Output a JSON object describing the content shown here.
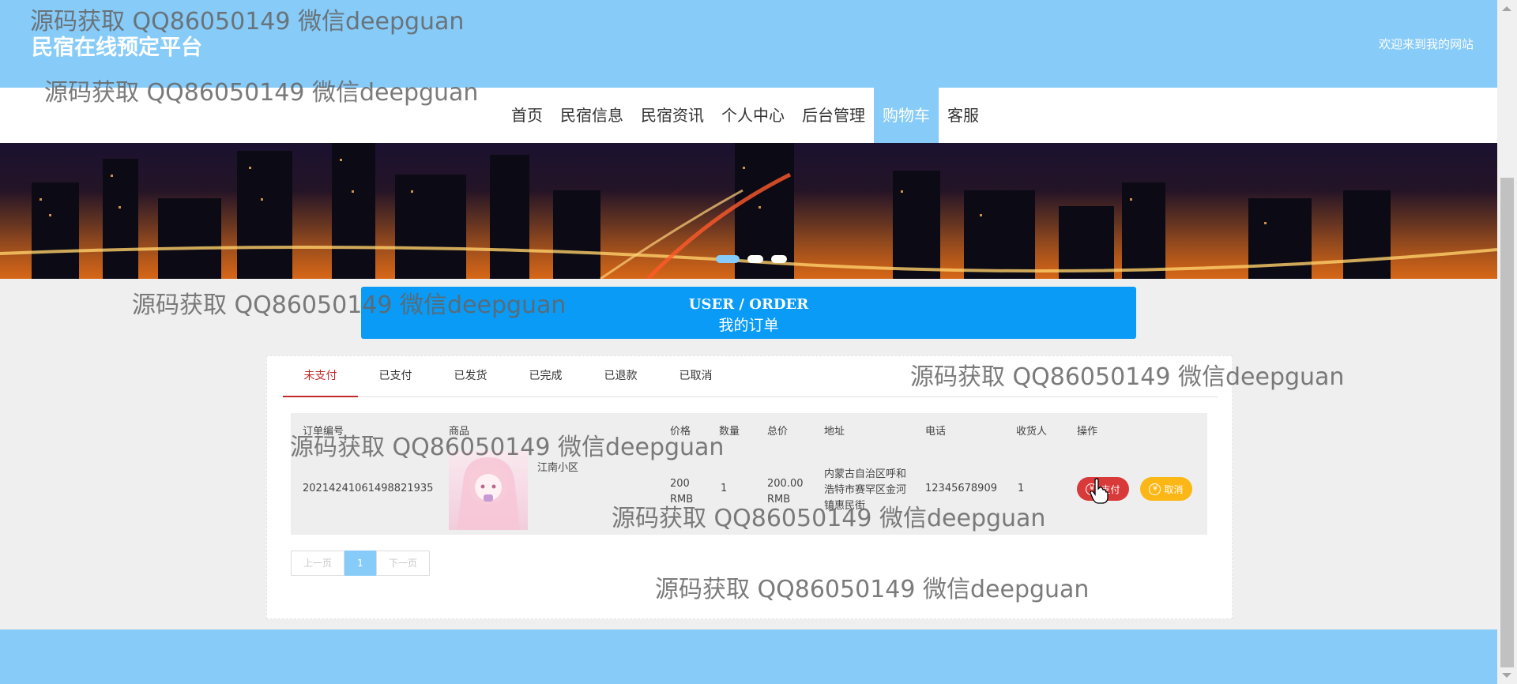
{
  "header": {
    "title": "民宿在线预定平台",
    "welcome": "欢迎来到我的网站"
  },
  "nav": {
    "items": [
      {
        "label": "首页"
      },
      {
        "label": "民宿信息"
      },
      {
        "label": "民宿资讯"
      },
      {
        "label": "个人中心"
      },
      {
        "label": "后台管理"
      },
      {
        "label": "购物车",
        "active": true
      },
      {
        "label": "客服"
      }
    ]
  },
  "order_section": {
    "title_en": "USER / ORDER",
    "title_cn": "我的订单"
  },
  "tabs": [
    "未支付",
    "已支付",
    "已发货",
    "已完成",
    "已退款",
    "已取消"
  ],
  "active_tab": "未支付",
  "table": {
    "headers": [
      "订单编号",
      "商品",
      "价格",
      "数量",
      "总价",
      "地址",
      "电话",
      "收货人",
      "操作"
    ],
    "row": {
      "order_no": "20214241061498821935",
      "product": "江南小区",
      "price": "200 RMB",
      "qty": "1",
      "total": "200.00 RMB",
      "address": "内蒙古自治区呼和浩特市赛罕区金河镇惠民街",
      "phone": "12345678909",
      "receiver": "1",
      "pay_label": "支付",
      "cancel_label": "取消"
    }
  },
  "pager": {
    "prev": "上一页",
    "current": "1",
    "next": "下一页"
  },
  "watermark": "源码获取 QQ86050149 微信deepguan",
  "colors": {
    "header": "#87cbf8",
    "order_header": "#0a9bf6",
    "pay": "#d83a3a",
    "cancel": "#fbb715",
    "active_tab": "#c22a2a"
  }
}
